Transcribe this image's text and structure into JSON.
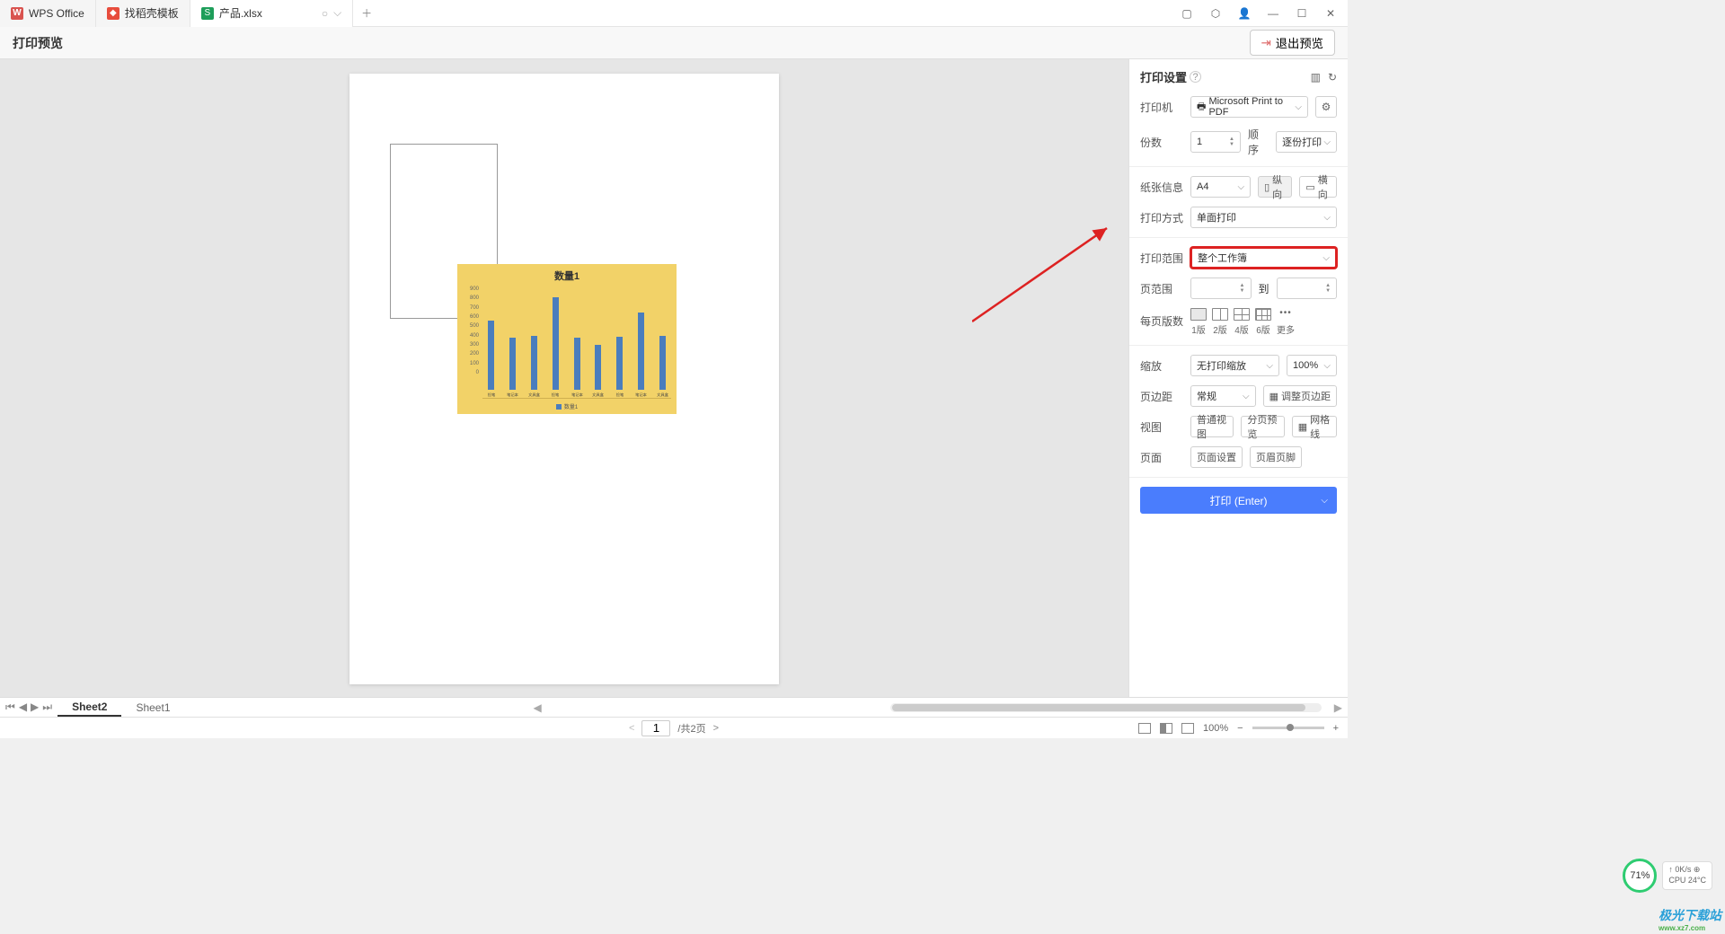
{
  "tabs": {
    "wps": "WPS Office",
    "template": "找稻壳模板",
    "file": "产品.xlsx"
  },
  "header": {
    "title": "打印预览",
    "exit": "退出预览"
  },
  "chart_data": {
    "type": "bar",
    "title": "数量1",
    "categories": [
      "捡笔",
      "笔记本",
      "文具盒",
      "捡笔",
      "笔记本",
      "文具盒",
      "捡笔",
      "笔记本",
      "文具盒"
    ],
    "values": [
      640,
      480,
      500,
      860,
      480,
      420,
      490,
      720,
      500
    ],
    "ylim": [
      0,
      900
    ],
    "yticks": [
      0,
      100,
      200,
      300,
      400,
      500,
      600,
      700,
      800,
      900
    ],
    "legend": "数量1"
  },
  "settings": {
    "title": "打印设置",
    "printer_label": "打印机",
    "printer_value": "Microsoft Print to PDF",
    "copies_label": "份数",
    "copies_value": "1",
    "order_label": "顺序",
    "order_value": "逐份打印",
    "paper_label": "纸张信息",
    "paper_value": "A4",
    "portrait": "纵向",
    "landscape": "横向",
    "method_label": "打印方式",
    "method_value": "单面打印",
    "range_label": "打印范围",
    "range_value": "整个工作簿",
    "pagerange_label": "页范围",
    "to": "到",
    "perpage_label": "每页版数",
    "layout1": "1版",
    "layout2": "2版",
    "layout4": "4版",
    "layout6": "6版",
    "layout_more": "更多",
    "zoom_label": "缩放",
    "zoom_value": "无打印缩放",
    "zoom_pct": "100%",
    "margin_label": "页边距",
    "margin_value": "常规",
    "margin_btn": "调整页边距",
    "view_label": "视图",
    "view_normal": "普通视图",
    "view_page": "分页预览",
    "view_grid": "网格线",
    "page_label": "页面",
    "page_setup": "页面设置",
    "page_header": "页眉页脚",
    "print_btn": "打印 (Enter)"
  },
  "sheets": {
    "s1": "Sheet2",
    "s2": "Sheet1"
  },
  "statusbar": {
    "page_value": "1",
    "total": "/共2页",
    "zoom": "100%"
  },
  "badge": {
    "pct": "71%",
    "net": "0K/s",
    "cpu": "CPU 24°C"
  },
  "watermark": {
    "name": "极光下载站",
    "url": "www.xz7.com"
  }
}
